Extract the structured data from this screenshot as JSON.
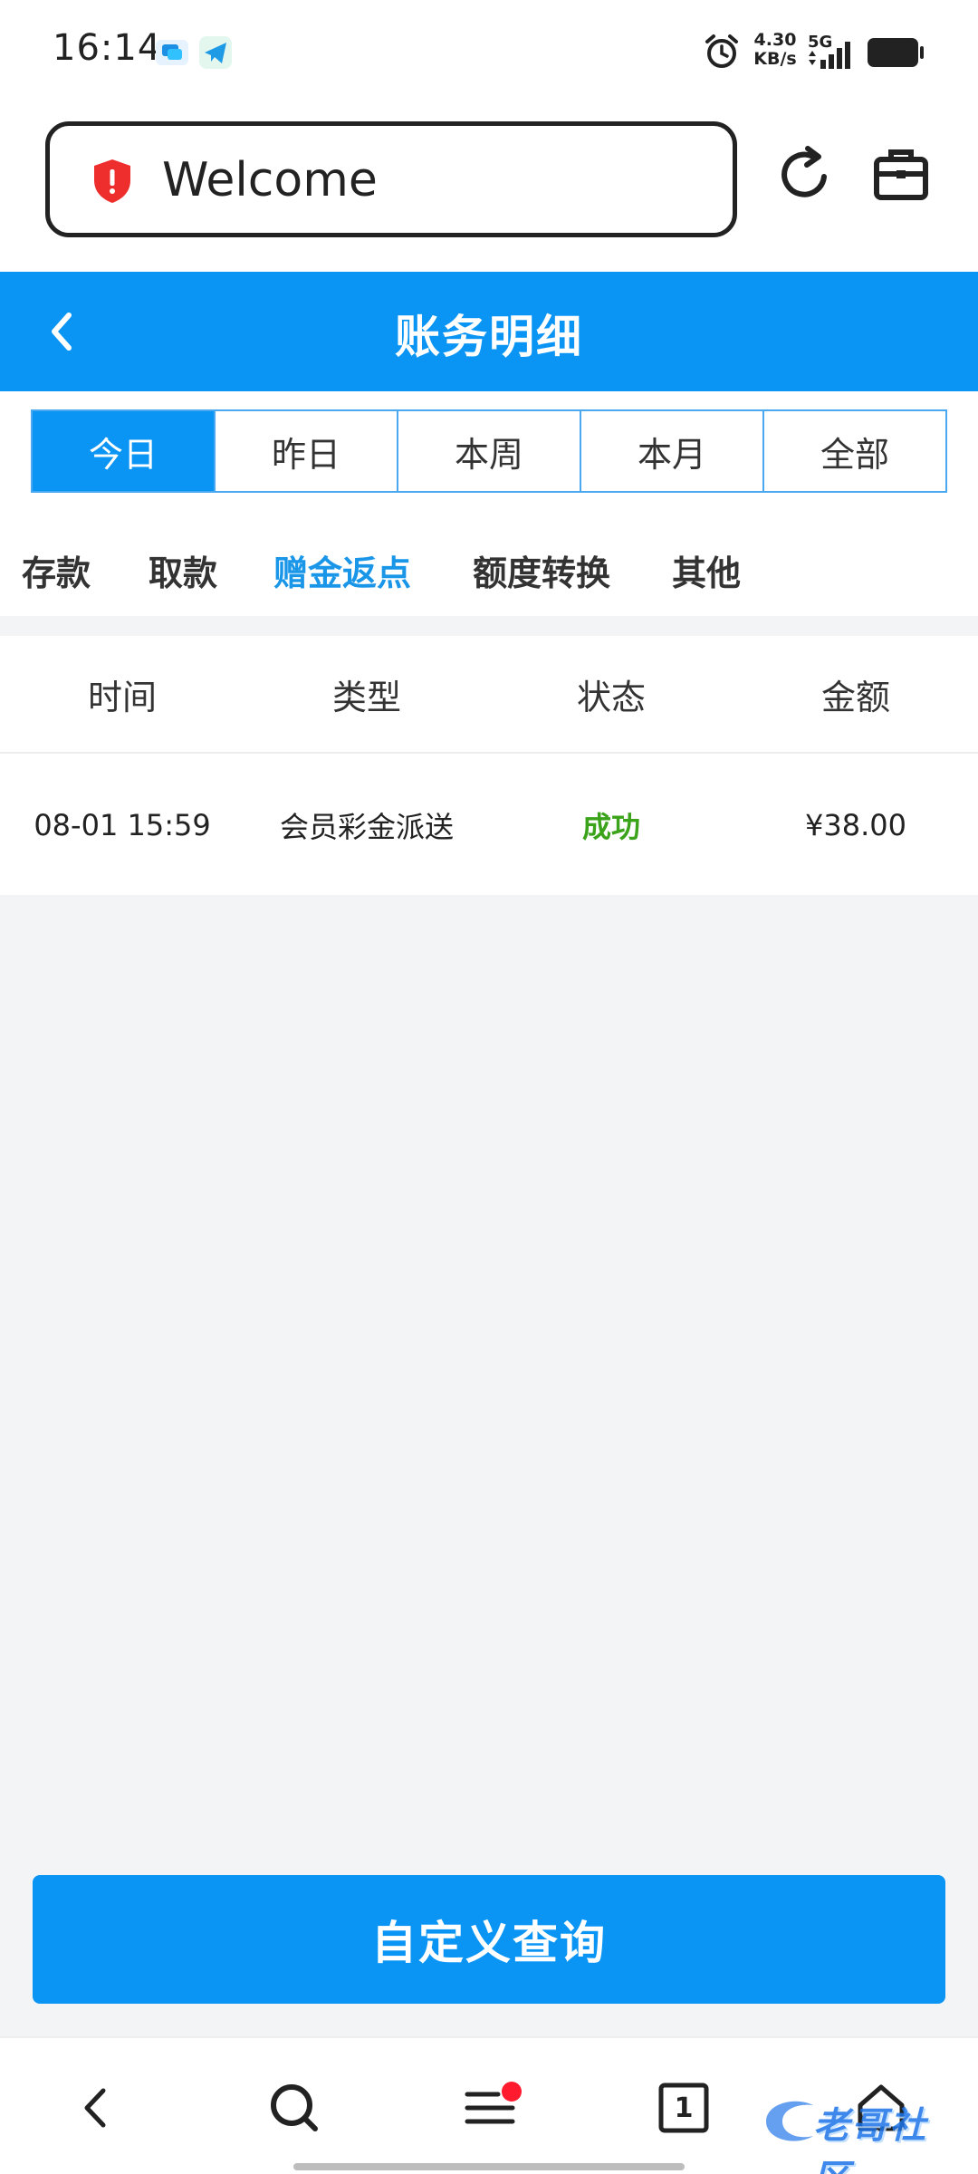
{
  "status_bar": {
    "time": "16:14",
    "net_speed_value": "4.30",
    "net_speed_unit": "KB/s",
    "signal_label": "5G",
    "icons": [
      "chat-notification-icon",
      "telegram-icon",
      "alarm-icon",
      "signal-icon",
      "battery-icon"
    ]
  },
  "browser": {
    "address_text": "Welcome",
    "security_icon": "shield-alert-icon",
    "actions": [
      "refresh-icon",
      "toolbox-icon"
    ]
  },
  "header": {
    "title": "账务明细",
    "back_icon": "chevron-left-icon"
  },
  "period_tabs": [
    {
      "label": "今日",
      "active": true
    },
    {
      "label": "昨日",
      "active": false
    },
    {
      "label": "本周",
      "active": false
    },
    {
      "label": "本月",
      "active": false
    },
    {
      "label": "全部",
      "active": false
    }
  ],
  "category_tabs": [
    {
      "label": "存款",
      "active": false
    },
    {
      "label": "取款",
      "active": false
    },
    {
      "label": "赠金返点",
      "active": true
    },
    {
      "label": "额度转换",
      "active": false
    },
    {
      "label": "其他",
      "active": false
    }
  ],
  "table": {
    "columns": [
      "时间",
      "类型",
      "状态",
      "金额"
    ],
    "rows": [
      {
        "time": "08-01 15:59",
        "type": "会员彩金派送",
        "status": "成功",
        "amount": "¥38.00"
      }
    ]
  },
  "query_button_label": "自定义查询",
  "bottom_nav": {
    "tab_count": "1",
    "items": [
      "back-icon",
      "search-icon",
      "menu-icon",
      "tabs-icon",
      "home-icon"
    ],
    "watermark": "老哥社区"
  },
  "colors": {
    "accent": "#0a95f5",
    "active_category": "#1a96e8",
    "success": "#3aa31a",
    "badge": "#ff1a2e"
  }
}
